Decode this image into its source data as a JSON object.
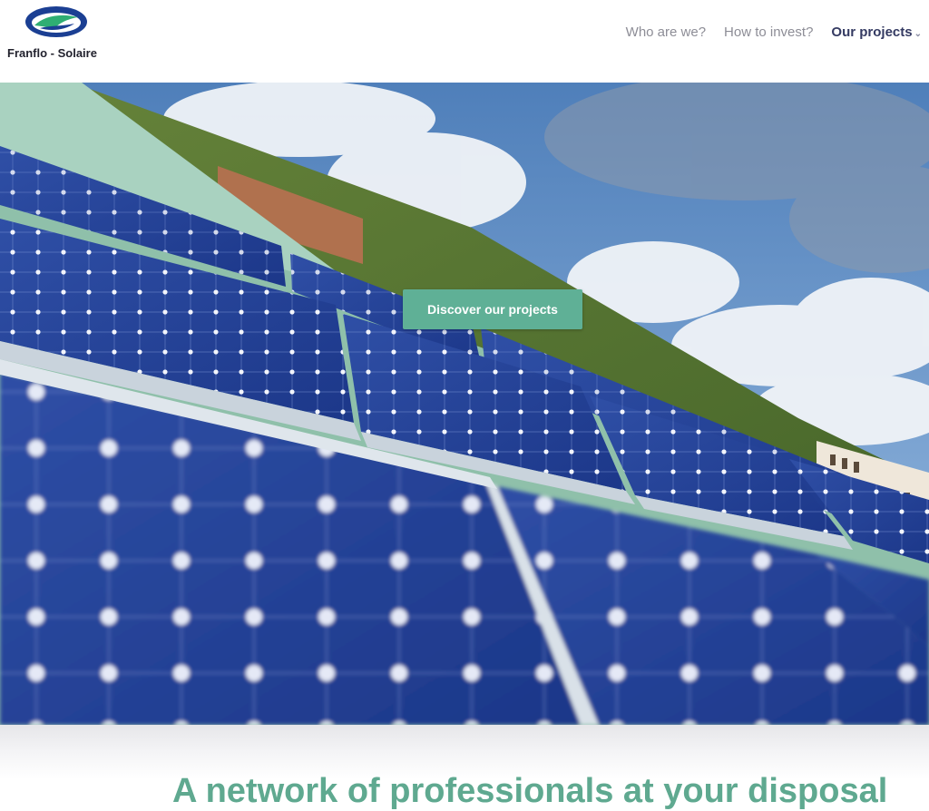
{
  "brand": {
    "name": "Franflo - Solaire",
    "logo_icon": "franflo-logo-icon",
    "colors": {
      "blue": "#1b3f93",
      "green": "#5fb096"
    }
  },
  "nav": {
    "items": [
      {
        "label": "Who are we?",
        "active": false
      },
      {
        "label": "How to invest?",
        "active": false
      },
      {
        "label": "Our projects",
        "active": true,
        "icon": "chevron-down-icon"
      }
    ]
  },
  "hero": {
    "image": "solar-panels-roof-photo",
    "cta_label": "Discover our projects"
  },
  "section": {
    "tagline": "A network of professionals at your disposal"
  }
}
